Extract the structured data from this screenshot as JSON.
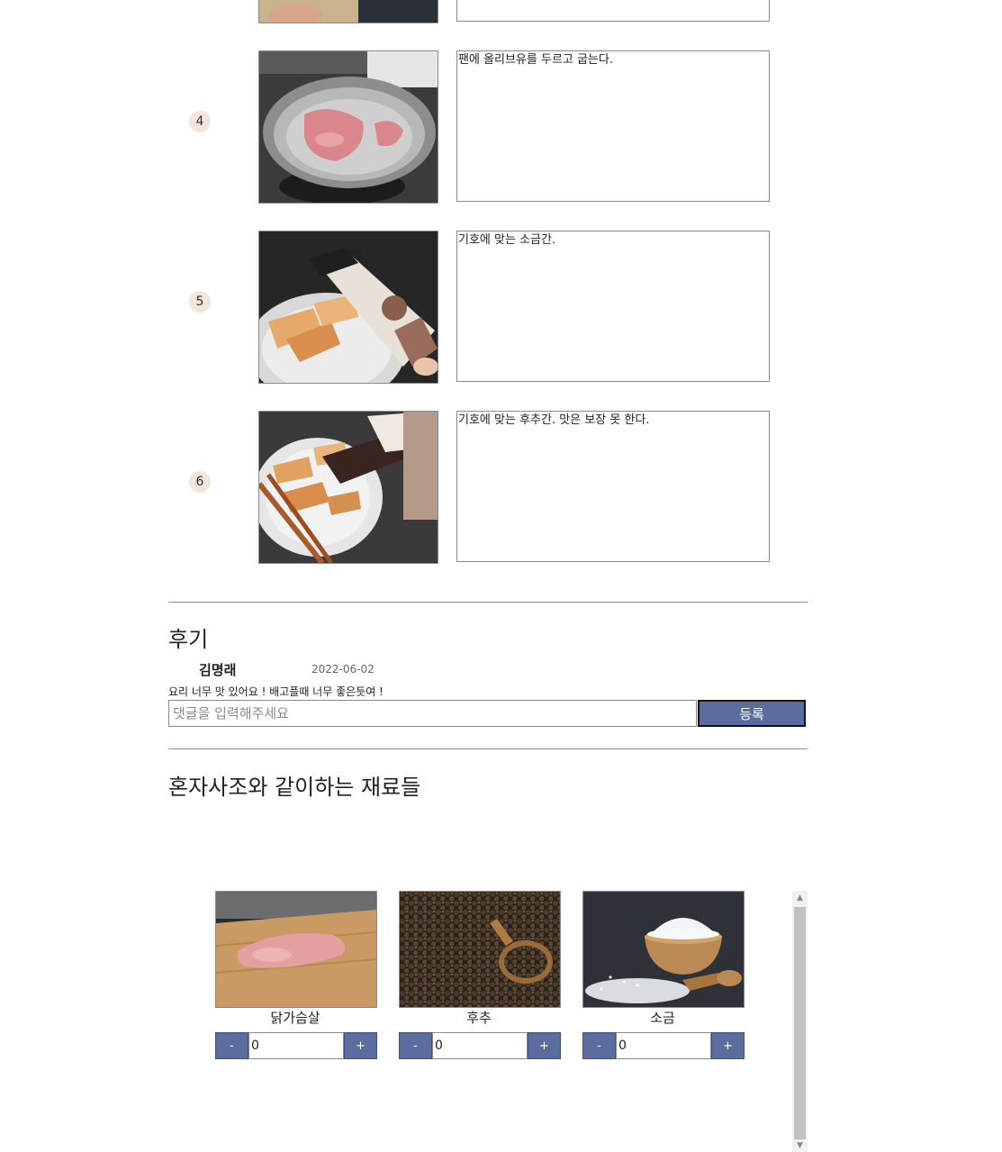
{
  "steps": [
    {
      "number": "4",
      "image_icon": "pan-with-meat-photo",
      "text": "팬에 올리브유를 두르고 굽는다."
    },
    {
      "number": "5",
      "image_icon": "salt-shaker-photo",
      "text": "기호에 맞는 소금간."
    },
    {
      "number": "6",
      "image_icon": "pepper-grinder-photo",
      "text": "기호에 맞는 후추간. 맛은 보장 못 한다."
    }
  ],
  "reviews": {
    "title": "후기",
    "items": [
      {
        "author": "김명래",
        "date": "2022-06-02",
        "body": "요리 너무 맛 있어요 ! 배고플때 너무 좋은듯여 !"
      }
    ],
    "comment_placeholder": "댓글을 입력해주세요",
    "comment_value": "",
    "submit_label": "등록"
  },
  "ingredients": {
    "title": "혼자사조와 같이하는 재료들",
    "items": [
      {
        "name": "닭가슴살",
        "image_icon": "chicken-breast-photo",
        "minus": "-",
        "plus": "+",
        "quantity": "0"
      },
      {
        "name": "후추",
        "image_icon": "peppercorns-photo",
        "minus": "-",
        "plus": "+",
        "quantity": "0"
      },
      {
        "name": "소금",
        "image_icon": "salt-bowl-photo",
        "minus": "-",
        "plus": "+",
        "quantity": "0"
      }
    ]
  },
  "colors": {
    "accent": "#5b6c9e",
    "step_badge": "#f1e6d9",
    "divider": "#8c8c8c"
  }
}
